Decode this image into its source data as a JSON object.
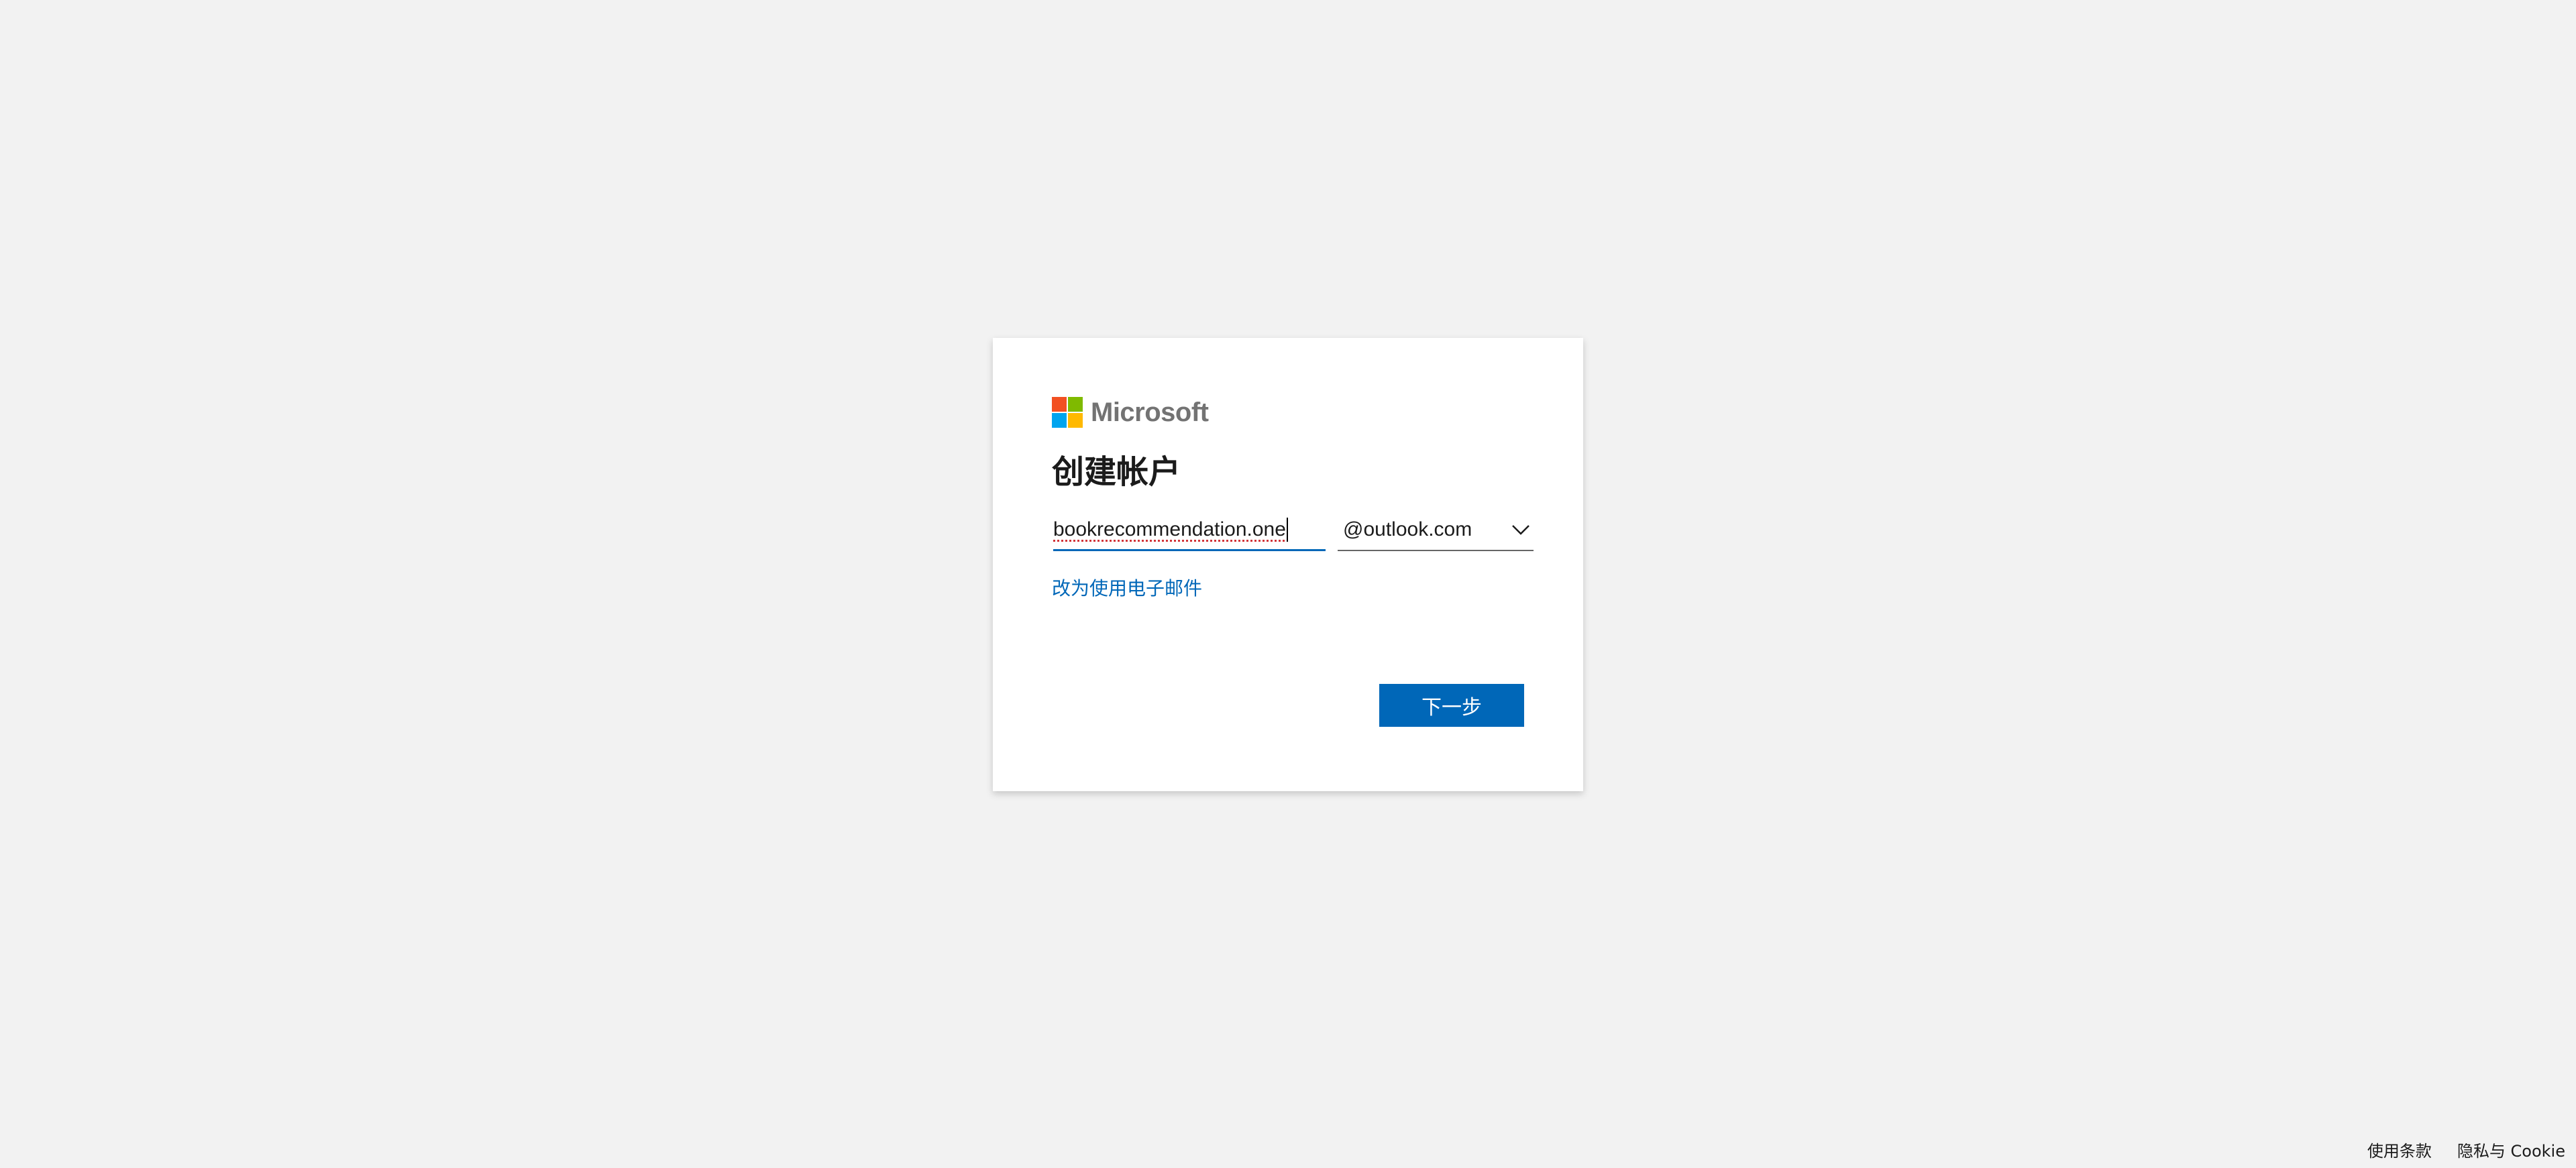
{
  "logo": {
    "text": "Microsoft",
    "colors": [
      "#f25022",
      "#7fba00",
      "#00a4ef",
      "#ffb900"
    ]
  },
  "title": "创建帐户",
  "form": {
    "username_value": "bookrecommendation.one",
    "domain_value": "@outlook.com",
    "switch_link": "改为使用电子邮件",
    "next_button": "下一步"
  },
  "footer": {
    "terms": "使用条款",
    "privacy": "隐私与 Cookie"
  },
  "colors": {
    "accent": "#0067b8",
    "background": "#f2f2f2"
  }
}
